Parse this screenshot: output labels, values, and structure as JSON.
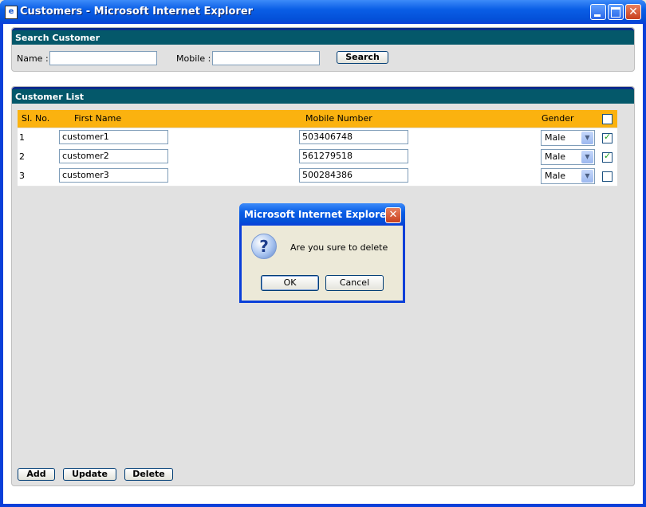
{
  "window": {
    "title": "Customers - Microsoft Internet Explorer",
    "icon": "ie-icon"
  },
  "search": {
    "header": "Search Customer",
    "name_label": "Name :",
    "name_value": "",
    "mobile_label": "Mobile :",
    "mobile_value": "",
    "button_label": "Search"
  },
  "list": {
    "header": "Customer List",
    "columns": [
      "Sl. No.",
      "First Name",
      "Mobile Number",
      "Gender"
    ],
    "rows": [
      {
        "sl": "1",
        "first_name": "customer1",
        "mobile": "503406748",
        "gender": "Male",
        "checked": true
      },
      {
        "sl": "2",
        "first_name": "customer2",
        "mobile": "561279518",
        "gender": "Male",
        "checked": true
      },
      {
        "sl": "3",
        "first_name": "customer3",
        "mobile": "500284386",
        "gender": "Male",
        "checked": false
      }
    ],
    "header_checked": false
  },
  "actions": {
    "add": "Add",
    "update": "Update",
    "delete": "Delete"
  },
  "dialog": {
    "title": "Microsoft Internet Explorer",
    "message": "Are you sure to delete",
    "ok": "OK",
    "cancel": "Cancel",
    "icon": "question-icon"
  },
  "colors": {
    "panel_header": "#04586a",
    "table_header": "#fbb20f",
    "titlebar": "#0a5ee6"
  }
}
